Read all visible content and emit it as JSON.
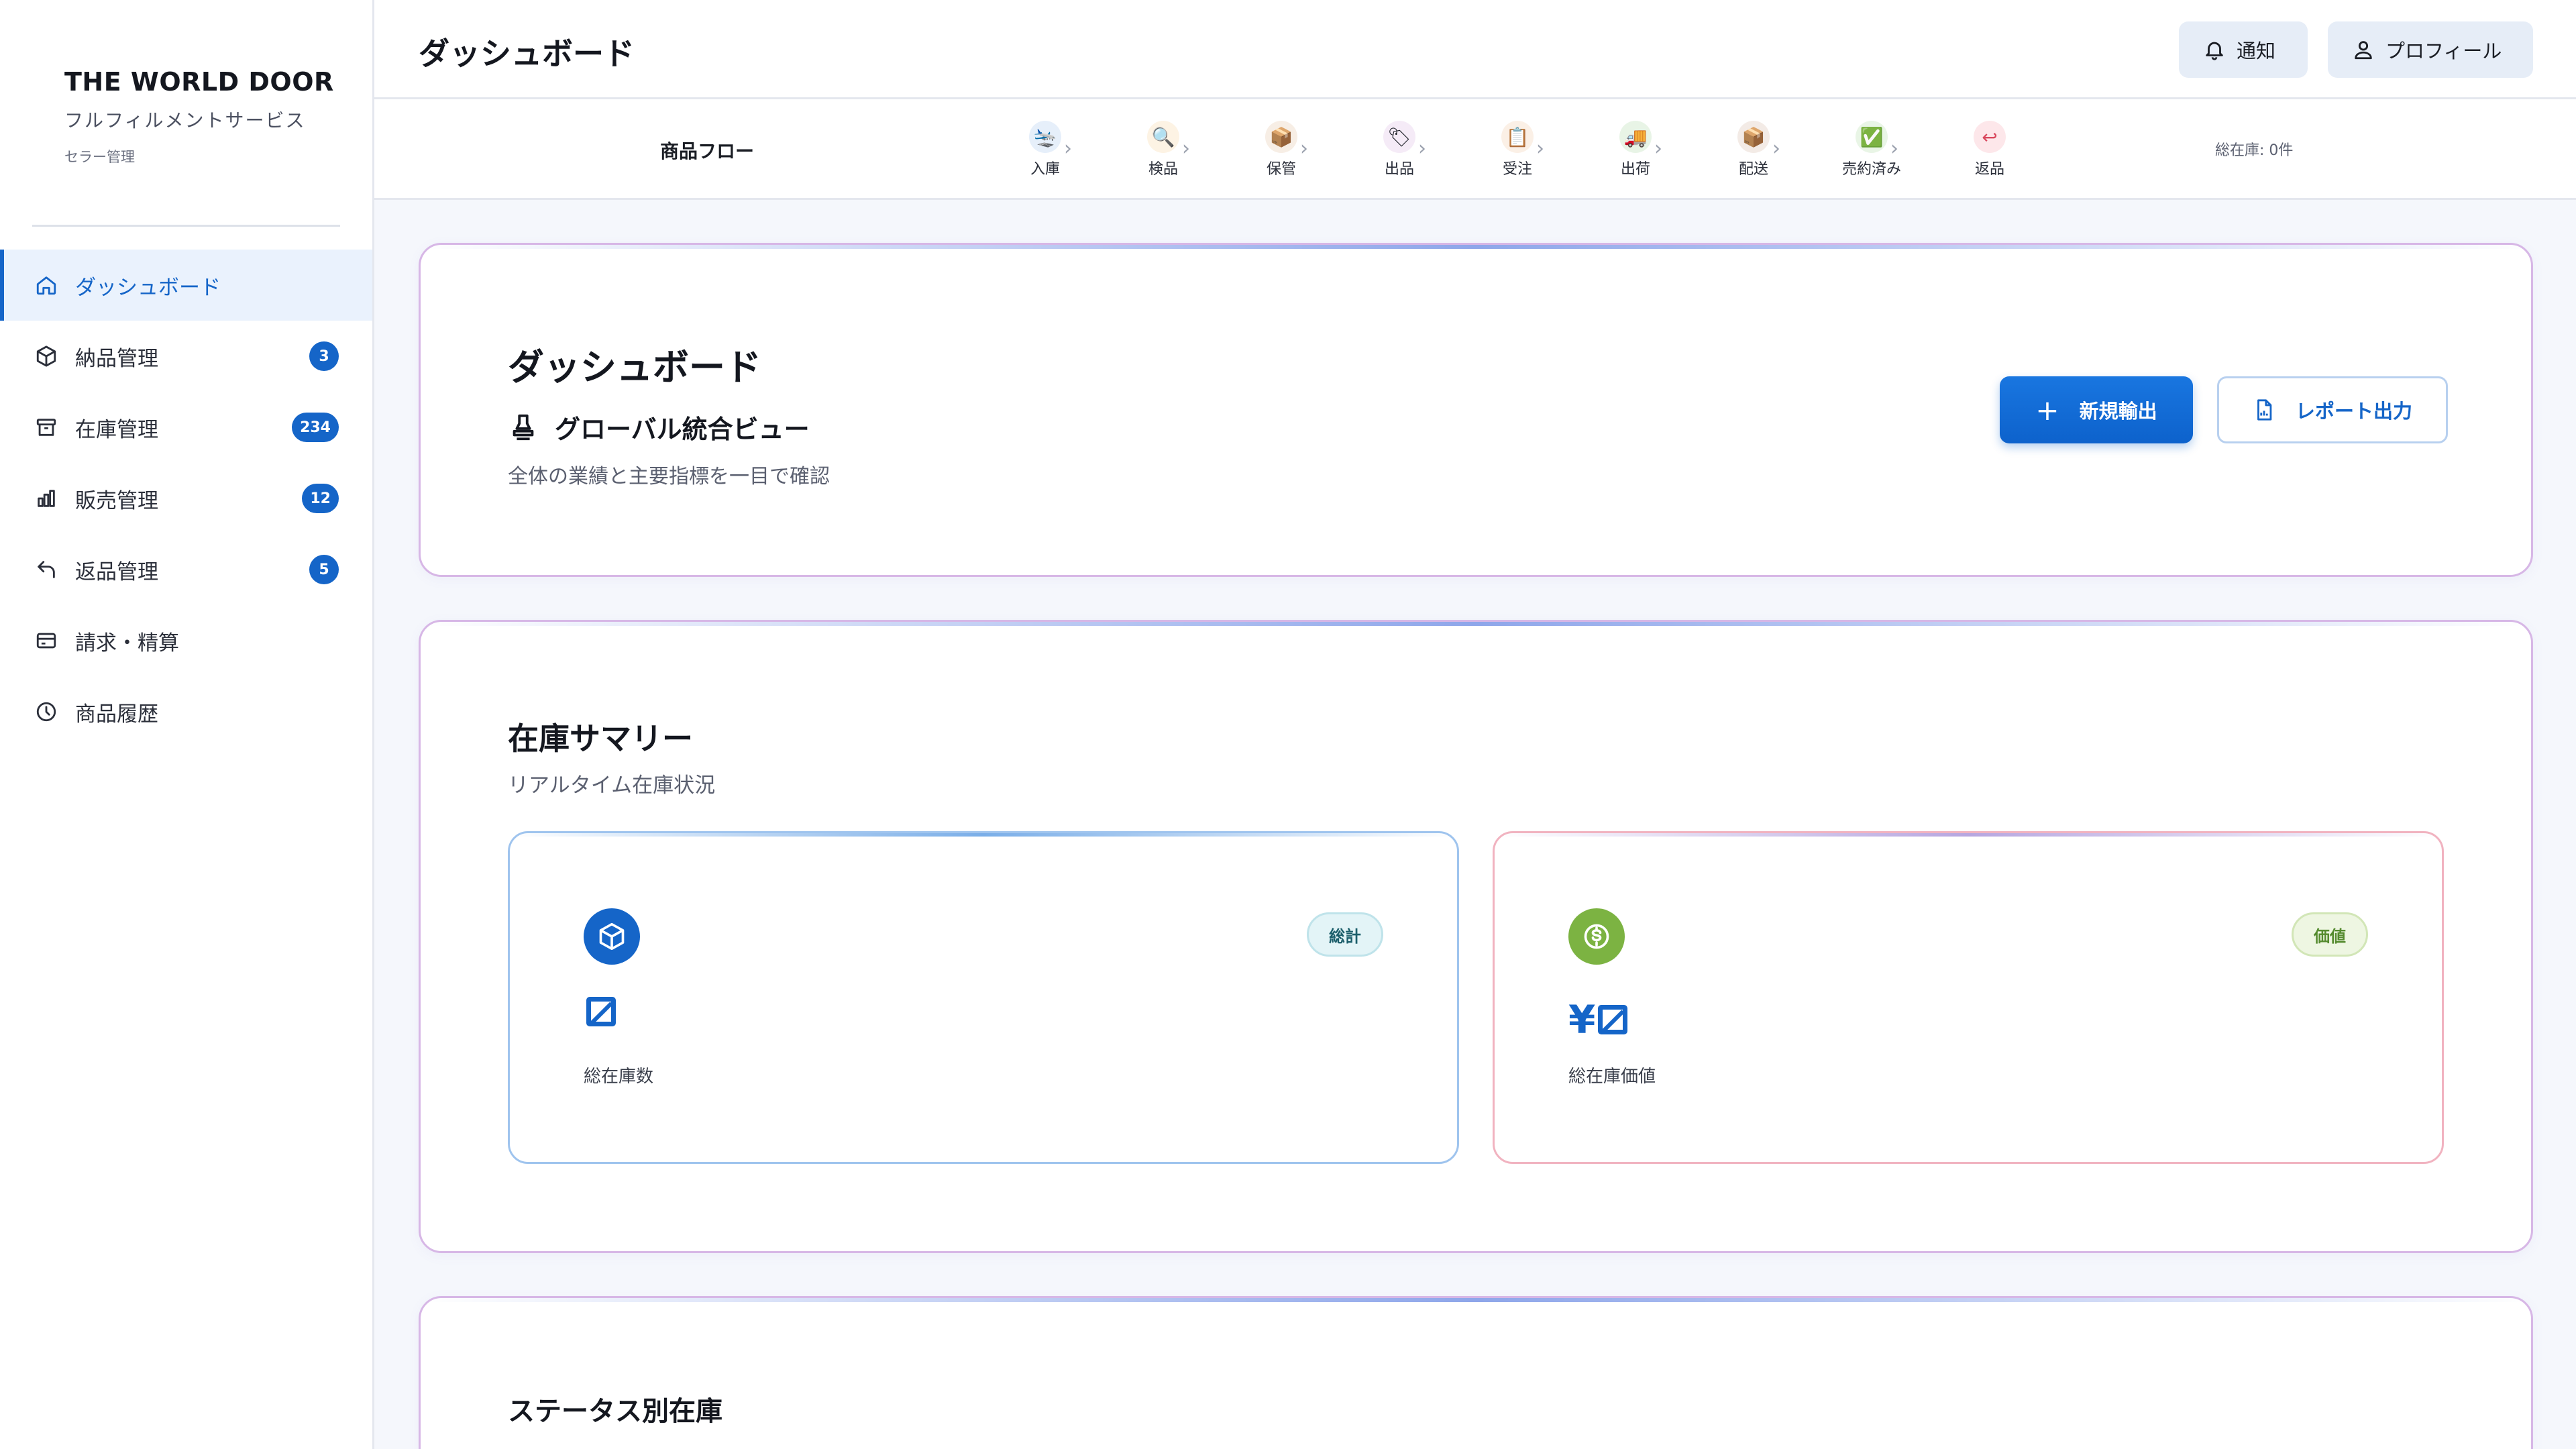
{
  "brand": {
    "name": "THE WORLD DOOR",
    "subtitle": "フルフィルメントサービス",
    "role": "セラー管理"
  },
  "sidebar": {
    "items": [
      {
        "label": "ダッシュボード",
        "icon": "home-icon",
        "badge": "",
        "active": true
      },
      {
        "label": "納品管理",
        "icon": "box-icon",
        "badge": "3"
      },
      {
        "label": "在庫管理",
        "icon": "archive-icon",
        "badge": "234"
      },
      {
        "label": "販売管理",
        "icon": "bar-chart-icon",
        "badge": "12"
      },
      {
        "label": "返品管理",
        "icon": "undo-icon",
        "badge": "5"
      },
      {
        "label": "請求・精算",
        "icon": "credit-card-icon",
        "badge": ""
      },
      {
        "label": "商品履歴",
        "icon": "clock-icon",
        "badge": ""
      }
    ]
  },
  "header": {
    "title": "ダッシュボード",
    "notify_label": "通知",
    "profile_label": "プロフィール"
  },
  "flow": {
    "label": "商品フロー",
    "steps": [
      {
        "label": "入庫",
        "icon": "🛬"
      },
      {
        "label": "検品",
        "icon": "🔍"
      },
      {
        "label": "保管",
        "icon": "📦"
      },
      {
        "label": "出品",
        "icon": "🏷"
      },
      {
        "label": "受注",
        "icon": "📋"
      },
      {
        "label": "出荷",
        "icon": "🚚"
      },
      {
        "label": "配送",
        "icon": "📦"
      },
      {
        "label": "売約済み",
        "icon": "✅"
      },
      {
        "label": "返品",
        "icon": "↩"
      }
    ],
    "total": "総在庫: 0件"
  },
  "overview": {
    "title": "ダッシュボード",
    "subtitle": "グローバル統合ビュー",
    "description": "全体の業績と主要指標を一目で確認",
    "new_export": "新規輸出",
    "report_export": "レポート出力"
  },
  "inventory": {
    "title": "在庫サマリー",
    "description": "リアルタイム在庫状況",
    "cards": [
      {
        "chip": "総計",
        "value_prefix": "",
        "value": "∅",
        "label": "総在庫数"
      },
      {
        "chip": "価値",
        "value_prefix": "¥",
        "value": "∅",
        "label": "総在庫価値"
      }
    ]
  },
  "status_section": {
    "title": "ステータス別在庫"
  },
  "colors": {
    "accent": "#1565c8",
    "success": "#7cb342",
    "card_border": "#d7b7e6"
  }
}
